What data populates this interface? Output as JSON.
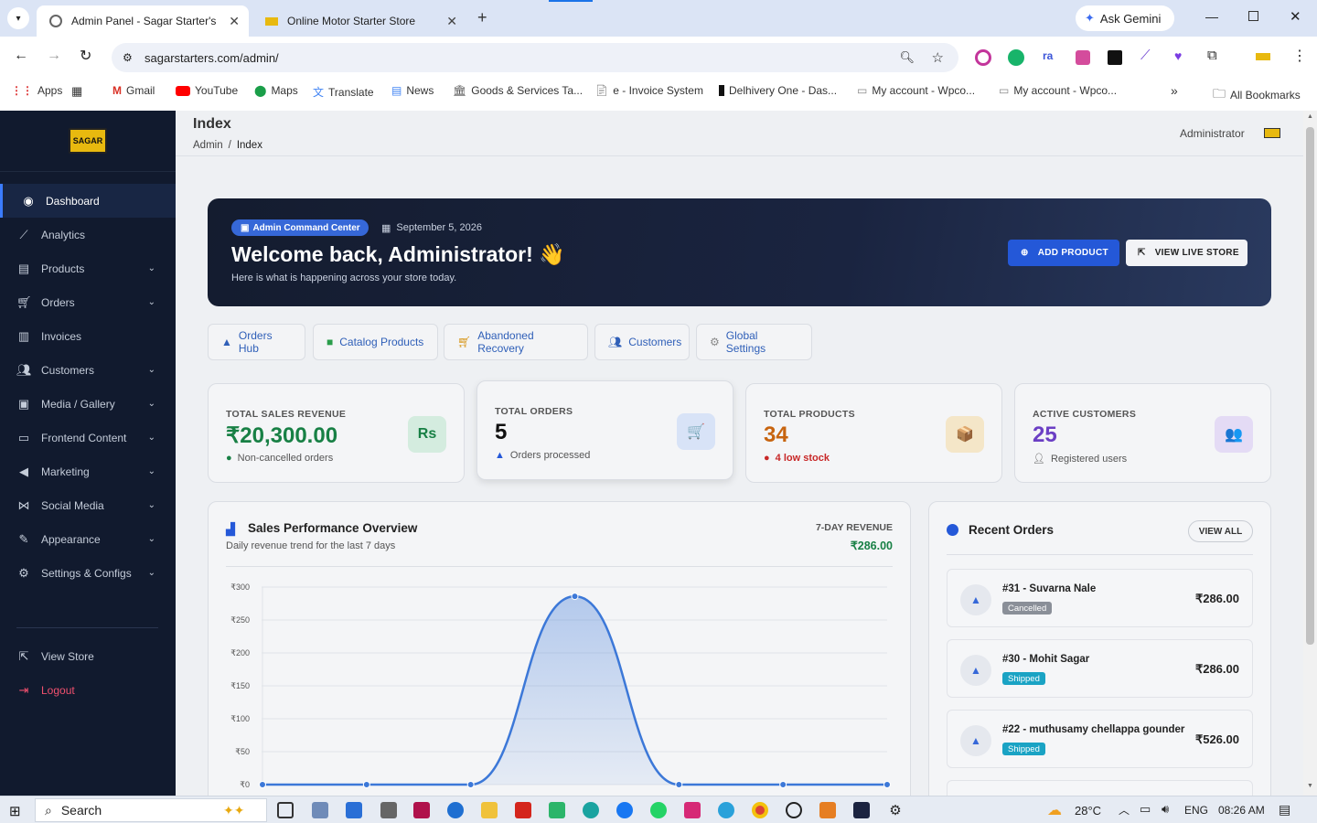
{
  "browser": {
    "tabs": [
      {
        "title": "Admin Panel - Sagar Starter's"
      },
      {
        "title": "Online Motor Starter Store"
      }
    ],
    "ask_gemini": "Ask Gemini",
    "url": "sagarstarters.com/admin/",
    "bookmarks": [
      "Apps",
      "Gmail",
      "YouTube",
      "Maps",
      "Translate",
      "News",
      "Goods & Services Ta...",
      "e - Invoice System",
      "Delhivery One - Das...",
      "My account - Wpco...",
      "My account - Wpco..."
    ],
    "all_bookmarks": "All Bookmarks"
  },
  "sidebar": {
    "logo_text": "SAGAR",
    "items": [
      {
        "label": "Dashboard",
        "icon": "dashboard-icon",
        "expand": false,
        "active": true
      },
      {
        "label": "Analytics",
        "icon": "chart-line-icon",
        "expand": false
      },
      {
        "label": "Products",
        "icon": "box-icon",
        "expand": true
      },
      {
        "label": "Orders",
        "icon": "cart-icon",
        "expand": true
      },
      {
        "label": "Invoices",
        "icon": "invoice-icon",
        "expand": false
      },
      {
        "label": "Customers",
        "icon": "users-icon",
        "expand": true
      },
      {
        "label": "Media / Gallery",
        "icon": "image-icon",
        "expand": true
      },
      {
        "label": "Frontend Content",
        "icon": "monitor-icon",
        "expand": true
      },
      {
        "label": "Marketing",
        "icon": "megaphone-icon",
        "expand": true
      },
      {
        "label": "Social Media",
        "icon": "share-icon",
        "expand": true
      },
      {
        "label": "Appearance",
        "icon": "brush-icon",
        "expand": true
      },
      {
        "label": "Settings & Configs",
        "icon": "gear-icon",
        "expand": true
      }
    ],
    "view_store": "View Store",
    "logout": "Logout"
  },
  "header": {
    "title": "Index",
    "breadcrumb": [
      "Admin",
      "/",
      "Index"
    ],
    "user": "Administrator"
  },
  "hero": {
    "badge": "Admin Command Center",
    "date": "September 5, 2026",
    "heading": "Welcome back, Administrator! 👋",
    "subtext": "Here is what is happening across your store today.",
    "add_product": "ADD PRODUCT",
    "view_store": "VIEW LIVE STORE"
  },
  "quick_links": [
    "Orders Hub",
    "Catalog Products",
    "Abandoned Recovery",
    "Customers",
    "Global Settings"
  ],
  "kpis": [
    {
      "label": "TOTAL SALES REVENUE",
      "value": "₹20,300.00",
      "sub": "Non-cancelled orders",
      "color": "#188045",
      "icon_text": "Rs"
    },
    {
      "label": "TOTAL ORDERS",
      "value": "5",
      "sub": "Orders processed",
      "color": "#111111",
      "icon_text": "🛒"
    },
    {
      "label": "TOTAL PRODUCTS",
      "value": "34",
      "sub": "4 low stock",
      "color": "#c7640f",
      "icon_text": "📦"
    },
    {
      "label": "ACTIVE CUSTOMERS",
      "value": "25",
      "sub": "Registered users",
      "color": "#6b3fc4",
      "icon_text": "👥"
    }
  ],
  "sales": {
    "title": "Sales Performance Overview",
    "subtitle": "Daily revenue trend for the last 7 days",
    "revenue_label": "7-DAY REVENUE",
    "revenue_value": "₹286.00"
  },
  "chart_data": {
    "type": "area",
    "x": [
      1,
      2,
      3,
      4,
      5,
      6,
      7
    ],
    "series": [
      {
        "values": [
          0,
          0,
          0,
          286,
          0,
          0,
          0
        ]
      }
    ],
    "ylim": [
      0,
      300
    ],
    "yticks": [
      "₹0",
      "₹50",
      "₹100",
      "₹150",
      "₹200",
      "₹250",
      "₹300"
    ],
    "grid": true,
    "color": "#3c78d8"
  },
  "recent_orders": {
    "title": "Recent Orders",
    "view_all": "VIEW ALL",
    "items": [
      {
        "title": "#31 - Suvarna Nale",
        "status": "Cancelled",
        "status_color": "#8a8f98",
        "amount": "₹286.00"
      },
      {
        "title": "#30 - Mohit Sagar",
        "status": "Shipped",
        "status_color": "#1aa3c4",
        "amount": "₹286.00"
      },
      {
        "title": "#22 - muthusamy chellappa gounder",
        "status": "Shipped",
        "status_color": "#1aa3c4",
        "amount": "₹526.00"
      }
    ]
  },
  "taskbar": {
    "search": "Search",
    "weather": "28°C",
    "lang": "ENG",
    "time": "08:26 AM"
  }
}
